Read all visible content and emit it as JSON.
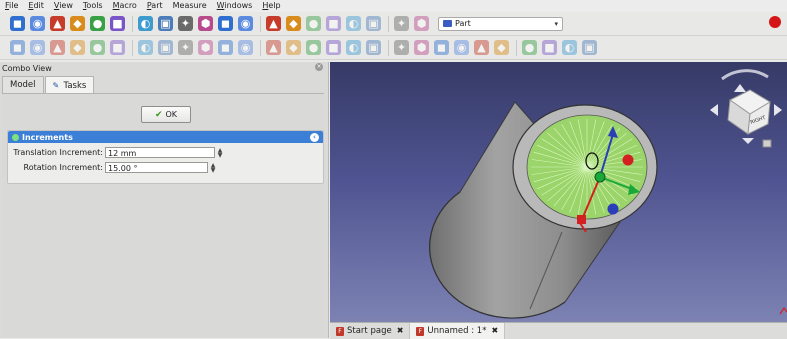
{
  "menu": [
    "File",
    "Edit",
    "View",
    "Tools",
    "Macro",
    "Part",
    "Measure",
    "Windows",
    "Help"
  ],
  "menu_mnemonics": [
    "F",
    "E",
    "V",
    "T",
    "M",
    "P",
    "",
    "W",
    "H"
  ],
  "toolbar": {
    "workbench_label": "Part",
    "workbench_icon": "part-workbench-icon",
    "row1_icons": [
      "new-document-icon",
      "zoom-fit-icon",
      "draw-style-icon",
      "render-icon",
      "back-arrow-icon",
      "forward-arrow-icon",
      "stereo-icon",
      "view-isometric-icon",
      "view-front-icon",
      "view-top-icon",
      "view-right-icon",
      "view-rear-icon",
      "view-bottom-icon",
      "view-left-icon",
      "measure-icon",
      "new-file-icon",
      "open-file-icon",
      "save-icon",
      "print-icon",
      "cut-icon",
      "copy-icon",
      "paste-icon",
      "undo-icon",
      "redo-icon",
      "refresh-icon"
    ],
    "row2_icons": [
      "box-icon",
      "cylinder-icon",
      "sphere-icon",
      "cone-icon",
      "torus-icon",
      "tube-icon",
      "primitives-icon",
      "shape-builder-icon",
      "extrude-icon",
      "revolve-icon",
      "mirror-icon",
      "fillet-icon",
      "chamfer-icon",
      "make-face-icon",
      "ruled-surface-icon",
      "loft-icon",
      "sweep-icon",
      "section-icon",
      "cross-sections-icon",
      "offset-icon",
      "thickness-icon",
      "projection-icon",
      "boolean-icon",
      "cut-bool-icon",
      "fuse-icon",
      "common-icon",
      "split-icon",
      "compound-icon",
      "check-geometry-icon",
      "defeaturing-icon",
      "measure-linear-icon"
    ]
  },
  "combo_view": {
    "title": "Combo View",
    "tab_model": "Model",
    "tab_tasks": "Tasks",
    "ok_label": "OK"
  },
  "increments": {
    "title": "Increments",
    "translation_label": "Translation Increment:",
    "translation_value": "12 mm",
    "rotation_label": "Rotation Increment:",
    "rotation_value": "15.00 °"
  },
  "navigation_cube": {
    "face_label": "RIGHT"
  },
  "doc_tabs": [
    {
      "label": "Start page"
    },
    {
      "label": "Unnamed : 1*"
    }
  ],
  "colors": {
    "viewport_top": "#363a66",
    "viewport_bottom": "#7d82b3",
    "panel_header": "#3b7fd6",
    "cylinder_body": "#8f8f8f",
    "hatch": "#8ee04a",
    "axis_z": "#2b3db8",
    "axis_x": "#d42020",
    "axis_y": "#1aa83a"
  }
}
